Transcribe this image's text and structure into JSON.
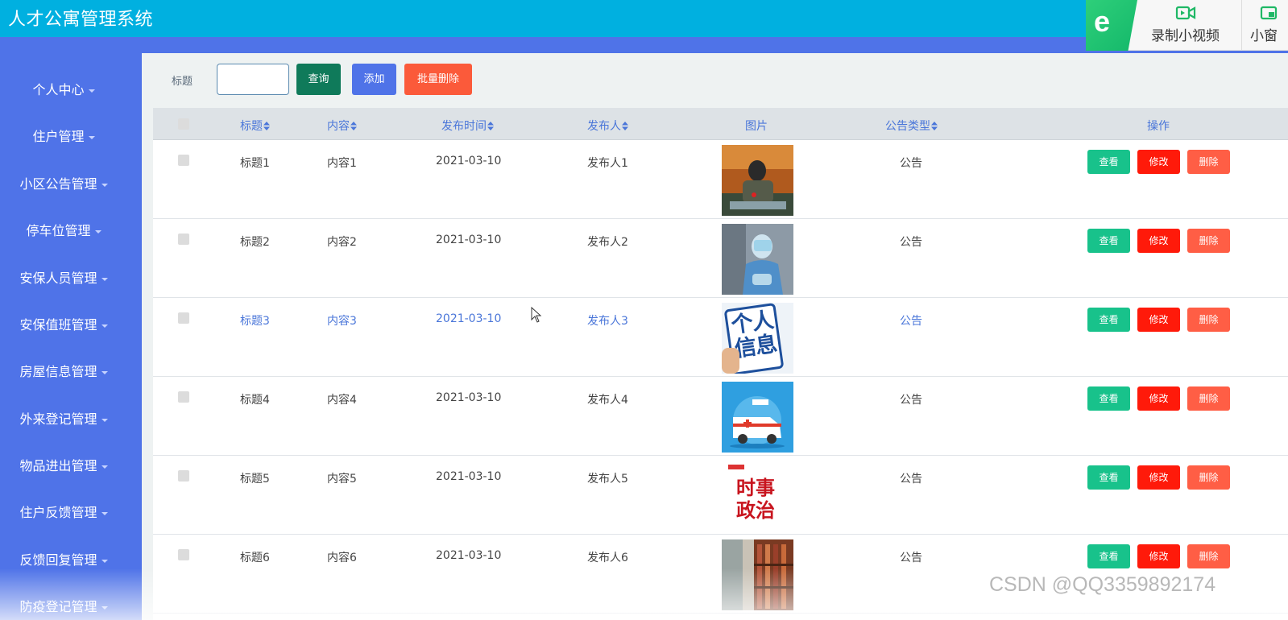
{
  "app": {
    "title": "人才公寓管理系统"
  },
  "overlay": {
    "items": [
      {
        "label": "录制小视频",
        "icon": "video-record-icon"
      },
      {
        "label": "小窗",
        "icon": "mini-window-icon"
      }
    ],
    "logo_letter": "e"
  },
  "sidebar": {
    "items": [
      {
        "label": "个人中心"
      },
      {
        "label": "住户管理"
      },
      {
        "label": "小区公告管理"
      },
      {
        "label": "停车位管理"
      },
      {
        "label": "安保人员管理"
      },
      {
        "label": "安保值班管理"
      },
      {
        "label": "房屋信息管理"
      },
      {
        "label": "外来登记管理"
      },
      {
        "label": "物品进出管理"
      },
      {
        "label": "住户反馈管理"
      },
      {
        "label": "反馈回复管理"
      },
      {
        "label": "防疫登记管理"
      }
    ]
  },
  "toolbar": {
    "search_label": "标题",
    "search_value": "",
    "query_label": "查询",
    "add_label": "添加",
    "batch_delete_label": "批量删除"
  },
  "table": {
    "headers": {
      "title": "标题",
      "content": "内容",
      "publish_time": "发布时间",
      "publisher": "发布人",
      "image": "图片",
      "notice_type": "公告类型",
      "actions": "操作"
    },
    "action_labels": {
      "view": "查看",
      "edit": "修改",
      "delete": "删除"
    },
    "rows": [
      {
        "title": "标题1",
        "content": "内容1",
        "publish_time": "2021-03-10",
        "publisher": "发布人1",
        "notice_type": "公告",
        "image": "photo-person-at-table"
      },
      {
        "title": "标题2",
        "content": "内容2",
        "publish_time": "2021-03-10",
        "publisher": "发布人2",
        "notice_type": "公告",
        "image": "photo-medical-worker"
      },
      {
        "title": "标题3",
        "content": "内容3",
        "publish_time": "2021-03-10",
        "publisher": "发布人3",
        "notice_type": "公告",
        "image": "image-personal-info",
        "image_text": "个人信息"
      },
      {
        "title": "标题4",
        "content": "内容4",
        "publish_time": "2021-03-10",
        "publisher": "发布人4",
        "notice_type": "公告",
        "image": "illustration-ambulance"
      },
      {
        "title": "标题5",
        "content": "内容5",
        "publish_time": "2021-03-10",
        "publisher": "发布人5",
        "notice_type": "公告",
        "image": "image-current-affairs",
        "image_text": "时事政治"
      },
      {
        "title": "标题6",
        "content": "内容6",
        "publish_time": "2021-03-10",
        "publisher": "发布人6",
        "notice_type": "公告",
        "image": "photo-bookshelves"
      }
    ]
  },
  "watermark": "CSDN @QQ3359892174",
  "colors": {
    "topbar": "#00b0e0",
    "sidebar": "#4f73e8",
    "view": "#18c28b",
    "edit": "#ff1a0a",
    "delete": "#ff5e45"
  }
}
